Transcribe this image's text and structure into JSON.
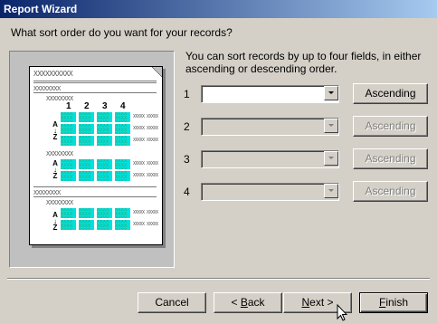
{
  "window": {
    "title": "Report Wizard"
  },
  "prompt": "What sort order do you want for your records?",
  "preview": {
    "placeholder": "XXXXXXXXXX",
    "group_placeholder": "XXXXXXXX",
    "cell_text": "XXXX XXXX XXXX",
    "extra_text": "XXXXX XXXXX",
    "column_numbers": [
      "1",
      "2",
      "3",
      "4"
    ],
    "sort_a": "A",
    "sort_arrow": "↓",
    "sort_z": "Z"
  },
  "intro": "You can sort records by up to four fields, in either ascending or descending order.",
  "sort_fields": [
    {
      "number": "1",
      "value": "",
      "enabled": true,
      "order": "Ascending"
    },
    {
      "number": "2",
      "value": "",
      "enabled": false,
      "order": "Ascending"
    },
    {
      "number": "3",
      "value": "",
      "enabled": false,
      "order": "Ascending"
    },
    {
      "number": "4",
      "value": "",
      "enabled": false,
      "order": "Ascending"
    }
  ],
  "buttons": {
    "cancel": "Cancel",
    "back_prefix": "< ",
    "back_accel": "B",
    "back_rest": "ack",
    "next_accel": "N",
    "next_rest": "ext >",
    "finish_accel": "F",
    "finish_rest": "inish"
  }
}
